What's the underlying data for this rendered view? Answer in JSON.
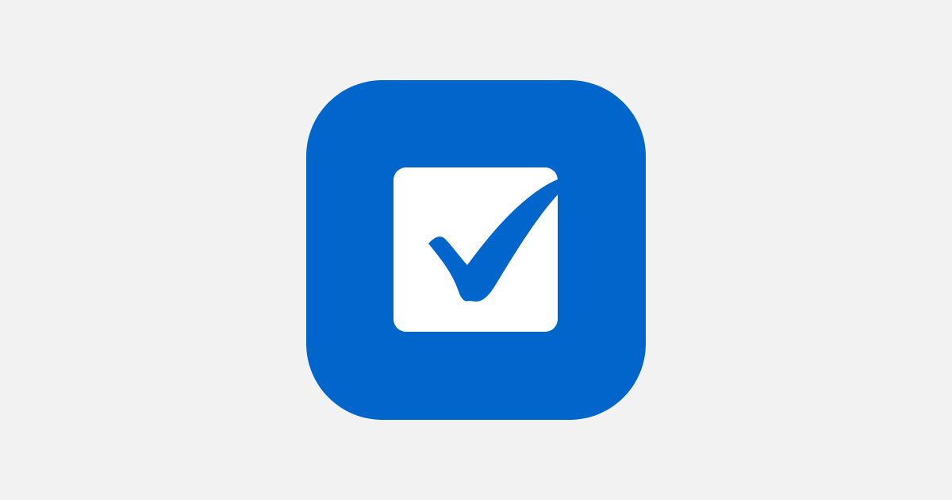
{
  "app_icon": {
    "icon_name": "checkbox-checkmark-icon",
    "background_color": "#f2f2f2",
    "tile_color": "#0066cc",
    "box_color": "#ffffff",
    "check_color": "#0066cc"
  }
}
